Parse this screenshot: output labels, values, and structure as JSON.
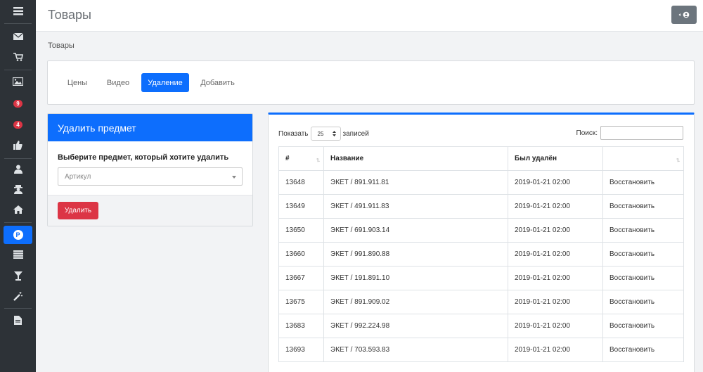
{
  "header": {
    "title": "Товары"
  },
  "breadcrumb": "Товары",
  "sidebar": {
    "badges": [
      "9",
      "4"
    ],
    "active_letter": "P"
  },
  "tabs": [
    {
      "label": "Цены",
      "active": false
    },
    {
      "label": "Видео",
      "active": false
    },
    {
      "label": "Удаление",
      "active": true
    },
    {
      "label": "Добавить",
      "active": false
    }
  ],
  "delete_panel": {
    "title": "Удалить предмет",
    "label": "Выберите предмет, который хотите удалить",
    "select_placeholder": "Артикул",
    "button": "Удалить"
  },
  "table": {
    "show_label": "Показать",
    "length_value": "25",
    "records_label": "записей",
    "search_label": "Поиск:",
    "columns": [
      "#",
      "Название",
      "Был удалён",
      ""
    ],
    "rows": [
      {
        "id": "13648",
        "name": "ЭКЕТ / 891.911.81",
        "deleted": "2019-01-21 02:00",
        "action": "Восстановить"
      },
      {
        "id": "13649",
        "name": "ЭКЕТ / 491.911.83",
        "deleted": "2019-01-21 02:00",
        "action": "Восстановить"
      },
      {
        "id": "13650",
        "name": "ЭКЕТ / 691.903.14",
        "deleted": "2019-01-21 02:00",
        "action": "Восстановить"
      },
      {
        "id": "13660",
        "name": "ЭКЕТ / 991.890.88",
        "deleted": "2019-01-21 02:00",
        "action": "Восстановить"
      },
      {
        "id": "13667",
        "name": "ЭКЕТ / 191.891.10",
        "deleted": "2019-01-21 02:00",
        "action": "Восстановить"
      },
      {
        "id": "13675",
        "name": "ЭКЕТ / 891.909.02",
        "deleted": "2019-01-21 02:00",
        "action": "Восстановить"
      },
      {
        "id": "13683",
        "name": "ЭКЕТ / 992.224.98",
        "deleted": "2019-01-21 02:00",
        "action": "Восстановить"
      },
      {
        "id": "13693",
        "name": "ЭКЕТ / 703.593.83",
        "deleted": "2019-01-21 02:00",
        "action": "Восстановить"
      }
    ]
  }
}
